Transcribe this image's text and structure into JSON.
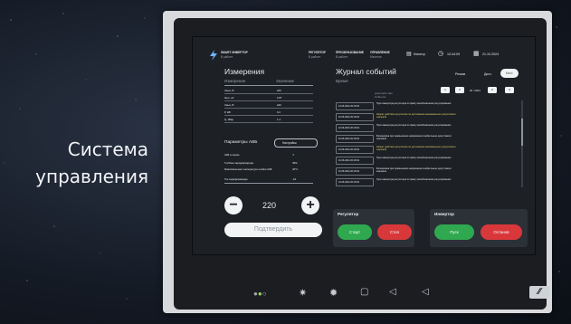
{
  "caption": {
    "line1": "Система",
    "line2": "управления"
  },
  "header": {
    "app_name": "SMART ИНВЕРТОР",
    "app_status": "В работе",
    "status1_title": "РЕГУЛЯТОР",
    "status1_value": "В работе",
    "status2_title": "ПРЕОБРАЗОВАНИЕ",
    "status2_value": "В работе",
    "status3_title": "УПРАВЛЕНИЕ",
    "status3_value": "Местное",
    "monitor_label": "Монитор",
    "time": "12:44:09",
    "date": "21.10.2024"
  },
  "measurements": {
    "title": "Измерения",
    "col_param": "Измерение",
    "col_value": "Значение",
    "rows": [
      {
        "name": "Uвых, В",
        "value": "220"
      },
      {
        "name": "Iвых, кА",
        "value": "0.87"
      },
      {
        "name": "Uвых, В",
        "value": "220"
      },
      {
        "name": "P, кВт",
        "value": "0.2"
      },
      {
        "name": "Q, кВар",
        "value": "1.4"
      }
    ]
  },
  "avr": {
    "title": "Параметры АВБ",
    "button": "Настройки",
    "rows": [
      {
        "name": "АКБ в норме",
        "value": "●"
      },
      {
        "name": "Глубина заряда/разряда",
        "value": "45%"
      },
      {
        "name": "Максимальная температура ячейки АКБ",
        "value": "32°C"
      },
      {
        "name": "Ток заряда/разряда",
        "value": "-44"
      }
    ]
  },
  "setpoint": {
    "minus": "−",
    "value": "220",
    "plus": "+",
    "confirm": "Подтвердить"
  },
  "journal": {
    "title": "Журнал событий",
    "col_time": "Время",
    "col_event": "Событие",
    "mode_label": "Режим",
    "mode_value": "Дист.",
    "mode_btn": "Мест.",
    "filter_chips": [
      "1",
      "2",
      "30 / 2024",
      "2",
      "3"
    ],
    "top_entry": "допустимого знач.",
    "entries": [
      {
        "time": "10.06.2024 20:18:34",
        "text": "Пуск инвертора регулятора по факту возобновления регулирования",
        "color": "#e8eaed"
      },
      {
        "time": "10.06.2024 20:18:34",
        "text": "Запрет действия регулятора по достижению минимального допустимого значения",
        "color": "#e3d46b"
      },
      {
        "time": "10.06.2024 20:18:34",
        "text": "Пуск инвертора регулятора по факту возобновления регулирования",
        "color": "#e8eaed"
      },
      {
        "time": "10.06.2024 20:18:34",
        "text": "Блокировка при превышении напряжения ячейки выше допустимого значения",
        "color": "#e8eaed"
      },
      {
        "time": "10.06.2024 20:18:34",
        "text": "Запрет действия регулятора по достижению минимального допустимого значения",
        "color": "#e3d46b"
      },
      {
        "time": "10.06.2024 20:18:34",
        "text": "Пуск инвертора регулятора по факту возобновления регулирования",
        "color": "#e8eaed"
      },
      {
        "time": "10.06.2024 20:18:34",
        "text": "Блокировка при превышении напряжения ячейки выше допустимого значения",
        "color": "#e8eaed"
      },
      {
        "time": "10.06.2024 20:18:34",
        "text": "Пуск инвертора регулятора по факту возобновления регулирования",
        "color": "#e8eaed"
      }
    ]
  },
  "regulator": {
    "title": "Регулятор",
    "start": "Старт",
    "stop": "Стоп"
  },
  "inverter": {
    "title": "Инвертор",
    "start": "Пуск",
    "stop": "Останов"
  },
  "colors": {
    "green": "#2fa84f",
    "red": "#d9383a",
    "accent": "#6fb6ff"
  }
}
